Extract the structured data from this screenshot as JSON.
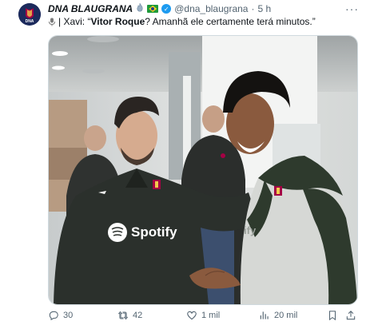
{
  "account": {
    "display_name": "DNA BLAUGRANA",
    "handle": "@dna_blaugrana",
    "separator": "·",
    "time": "5 h",
    "avatar_text": "DNA"
  },
  "tweet": {
    "prefix": "| Xavi: “",
    "player_bold": "Vitor Roque",
    "rest": "? Amanhã ele certamente terá minutos.”"
  },
  "media": {
    "shirt_sponsor": "Spotify"
  },
  "actions": {
    "replies": "30",
    "retweets": "42",
    "likes": "1 mil",
    "views": "20 mil"
  },
  "icons": [
    "more-icon",
    "mic-icon",
    "verified-icon",
    "brazil-flag-icon",
    "reply-icon",
    "retweet-icon",
    "like-icon",
    "views-icon",
    "bookmark-icon",
    "share-icon"
  ],
  "colors": {
    "accent": "#1d9bf0",
    "muted": "#536471"
  }
}
